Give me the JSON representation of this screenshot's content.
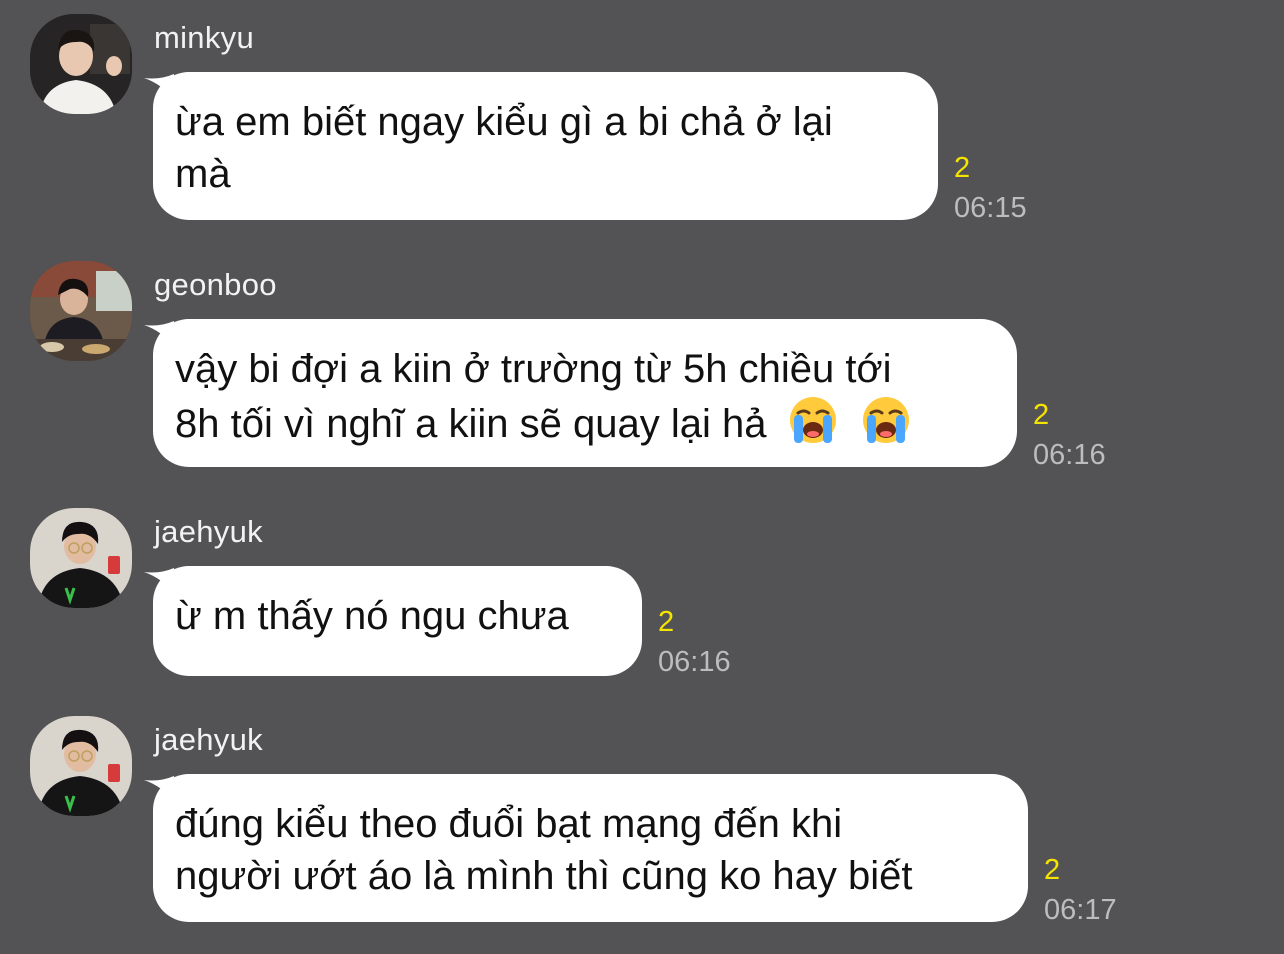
{
  "messages": [
    {
      "sender": "minkyu",
      "lines": [
        "ừa em biết ngay kiểu gì a bi chả ở lại",
        "mà"
      ],
      "unread": "2",
      "time": "06:15",
      "avatar": "minkyu-avatar"
    },
    {
      "sender": "geonboo",
      "lines": [
        "vậy bi đợi a kiin ở trường từ 5h chiều tới",
        "8h tối vì nghĩ a kiin sẽ quay lại hả"
      ],
      "emoji": [
        "loudly-crying-face-icon",
        "loudly-crying-face-icon"
      ],
      "unread": "2",
      "time": "06:16",
      "avatar": "geonboo-avatar"
    },
    {
      "sender": "jaehyuk",
      "lines": [
        "ừ m thấy nó ngu chưa"
      ],
      "unread": "2",
      "time": "06:16",
      "avatar": "jaehyuk-avatar"
    },
    {
      "sender": "jaehyuk",
      "lines": [
        "đúng kiểu theo đuổi bạt mạng đến khi",
        "người ướt áo là mình thì cũng ko hay biết"
      ],
      "unread": "2",
      "time": "06:17",
      "avatar": "jaehyuk-avatar"
    }
  ],
  "colors": {
    "background": "#535254",
    "bubble": "#ffffff",
    "unread": "#f5e400",
    "time": "#bdbcbe"
  }
}
